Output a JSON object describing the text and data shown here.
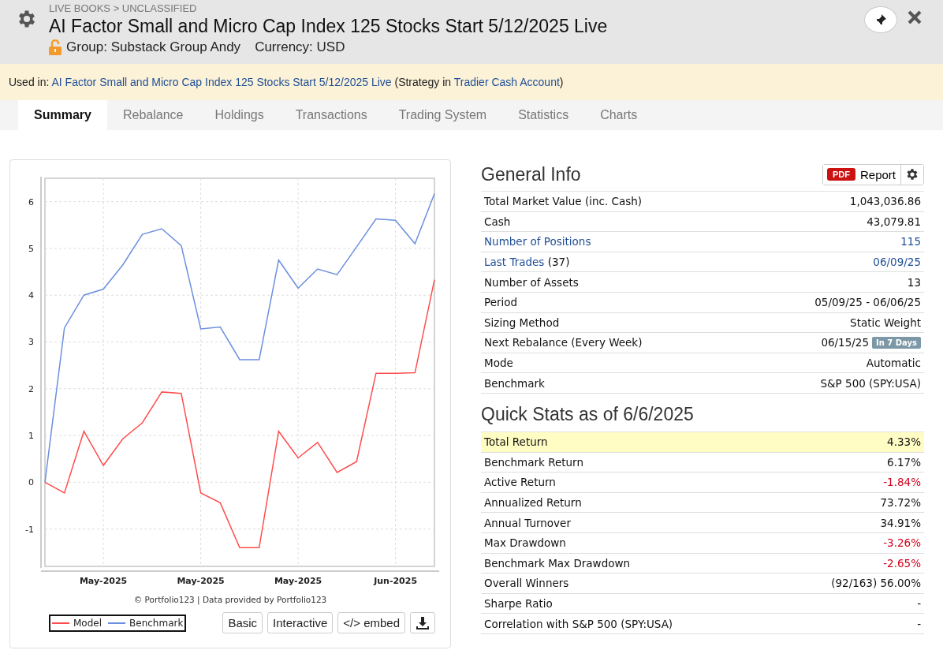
{
  "header": {
    "breadcrumb": "LIVE BOOKS > UNCLASSIFIED",
    "title": "AI Factor Small and Micro Cap Index 125 Stocks Start 5/12/2025 Live",
    "group": "Group: Substack Group Andy",
    "currency": "Currency: USD"
  },
  "used_in": {
    "label": "Used in:",
    "link": "AI Factor Small and Micro Cap Index 125 Stocks Start 5/12/2025 Live",
    "middle": "(Strategy in",
    "account": "Tradier Cash Account",
    "end": ")"
  },
  "tabs": [
    {
      "label": "Summary",
      "selected": true
    },
    {
      "label": "Rebalance",
      "selected": false
    },
    {
      "label": "Holdings",
      "selected": false
    },
    {
      "label": "Transactions",
      "selected": false
    },
    {
      "label": "Trading System",
      "selected": false
    },
    {
      "label": "Statistics",
      "selected": false
    },
    {
      "label": "Charts",
      "selected": false
    }
  ],
  "chart": {
    "credit": "© Portfolio123 | Data provided by Portfolio123",
    "buttons": [
      "Basic",
      "Interactive",
      "</> embed"
    ],
    "chart_data": {
      "type": "line",
      "grid": true,
      "categories": [
        null,
        null,
        null,
        "May-2025",
        null,
        null,
        null,
        null,
        "May-2025",
        null,
        null,
        null,
        null,
        "May-2025",
        null,
        null,
        null,
        null,
        "Jun-2025",
        null,
        null
      ],
      "ylim": [
        -1.8,
        6.5
      ],
      "yticks": [
        -1,
        0,
        1,
        2,
        3,
        4,
        5,
        6
      ],
      "series": [
        {
          "name": "Model",
          "color": "#ff4d4d",
          "values": [
            0,
            -0.23,
            1.09,
            0.36,
            0.93,
            1.27,
            1.93,
            1.9,
            -0.23,
            -0.44,
            -1.4,
            -1.4,
            1.09,
            0.52,
            0.85,
            0.21,
            0.44,
            2.33,
            2.33,
            2.34,
            4.33
          ]
        },
        {
          "name": "Benchmark",
          "color": "#6b8fe0",
          "values": [
            0,
            3.3,
            4.0,
            4.13,
            4.65,
            5.3,
            5.42,
            5.06,
            3.28,
            3.32,
            2.62,
            2.62,
            4.75,
            4.15,
            4.56,
            4.44,
            5.03,
            5.63,
            5.6,
            5.1,
            6.17
          ]
        }
      ]
    }
  },
  "general_info": {
    "title": "General Info",
    "pdf_badge": "PDF",
    "report": "Report",
    "rows": [
      {
        "label": "Total Market Value (inc. Cash)",
        "value": "1,043,036.86",
        "link": false
      },
      {
        "label": "Cash",
        "value": "43,079.81",
        "link": false
      },
      {
        "label": "Number of Positions",
        "value": "115",
        "link": true
      },
      {
        "label": "Last Trades",
        "label_suffix": "(37)",
        "value": "06/09/25",
        "link": true
      },
      {
        "label": "Number of Assets",
        "value": "13",
        "link": false
      },
      {
        "label": "Period",
        "value": "05/09/25 - 06/06/25",
        "link": false
      },
      {
        "label": "Sizing Method",
        "value": "Static Weight",
        "link": false
      },
      {
        "label": "Next Rebalance (Every Week)",
        "value": "06/15/25",
        "badge": "In 7 Days",
        "link": false
      },
      {
        "label": "Mode",
        "value": "Automatic",
        "link": false
      },
      {
        "label": "Benchmark",
        "value": "S&P 500 (SPY:USA)",
        "link": false
      }
    ]
  },
  "quick_stats": {
    "title": "Quick Stats as of 6/6/2025",
    "rows": [
      {
        "label": "Total Return",
        "value": "4.33%",
        "highlighted": true,
        "negative": false
      },
      {
        "label": "Benchmark Return",
        "value": "6.17%",
        "highlighted": false,
        "negative": false
      },
      {
        "label": "Active Return",
        "value": "-1.84%",
        "highlighted": false,
        "negative": true
      },
      {
        "label": "Annualized Return",
        "value": "73.72%",
        "highlighted": false,
        "negative": false
      },
      {
        "label": "Annual Turnover",
        "value": "34.91%",
        "highlighted": false,
        "negative": false
      },
      {
        "label": "Max Drawdown",
        "value": "-3.26%",
        "highlighted": false,
        "negative": true
      },
      {
        "label": "Benchmark Max Drawdown",
        "value": "-2.65%",
        "highlighted": false,
        "negative": true
      },
      {
        "label": "Overall Winners",
        "value": "(92/163) 56.00%",
        "highlighted": false,
        "negative": false
      },
      {
        "label": "Sharpe Ratio",
        "value": "-",
        "highlighted": false,
        "negative": false
      },
      {
        "label": "Correlation with S&P 500 (SPY:USA)",
        "value": "-",
        "highlighted": false,
        "negative": false
      }
    ]
  }
}
